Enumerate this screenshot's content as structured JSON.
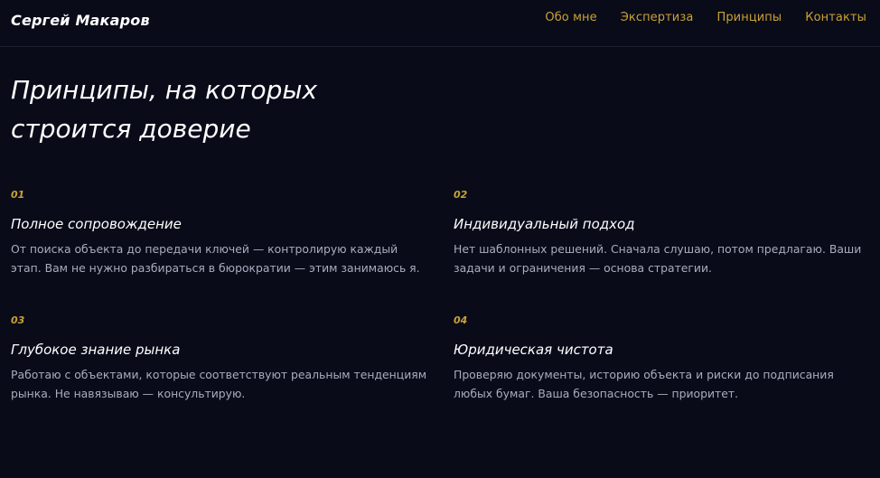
{
  "header": {
    "logo": "Сергей Макаров",
    "nav": [
      "Обо мне",
      "Экспертиза",
      "Принципы",
      "Контакты"
    ]
  },
  "section": {
    "title": "Принципы, на которых строится доверие"
  },
  "principles": [
    {
      "number": "01",
      "title": "Полное сопровождение",
      "description": "От поиска объекта до передачи ключей — контролирую каждый этап. Вам не нужно разбираться в бюрократии — этим занимаюсь я."
    },
    {
      "number": "02",
      "title": "Индивидуальный подход",
      "description": "Нет шаблонных решений. Сначала слушаю, потом предлагаю. Ваши задачи и ограничения — основа стратегии."
    },
    {
      "number": "03",
      "title": "Глубокое знание рынка",
      "description": "Работаю с объектами, которые соответствуют реальным тенденциям рынка. Не навязываю — консультирую."
    },
    {
      "number": "04",
      "title": "Юридическая чистота",
      "description": "Проверяю документы, историю объекта и риски до подписания любых бумаг. Ваша безопасность — приоритет."
    }
  ],
  "colors": {
    "background": "#090b19",
    "accent": "#c9a136",
    "text": "#ffffff",
    "muted_text": "#a8adbd"
  }
}
